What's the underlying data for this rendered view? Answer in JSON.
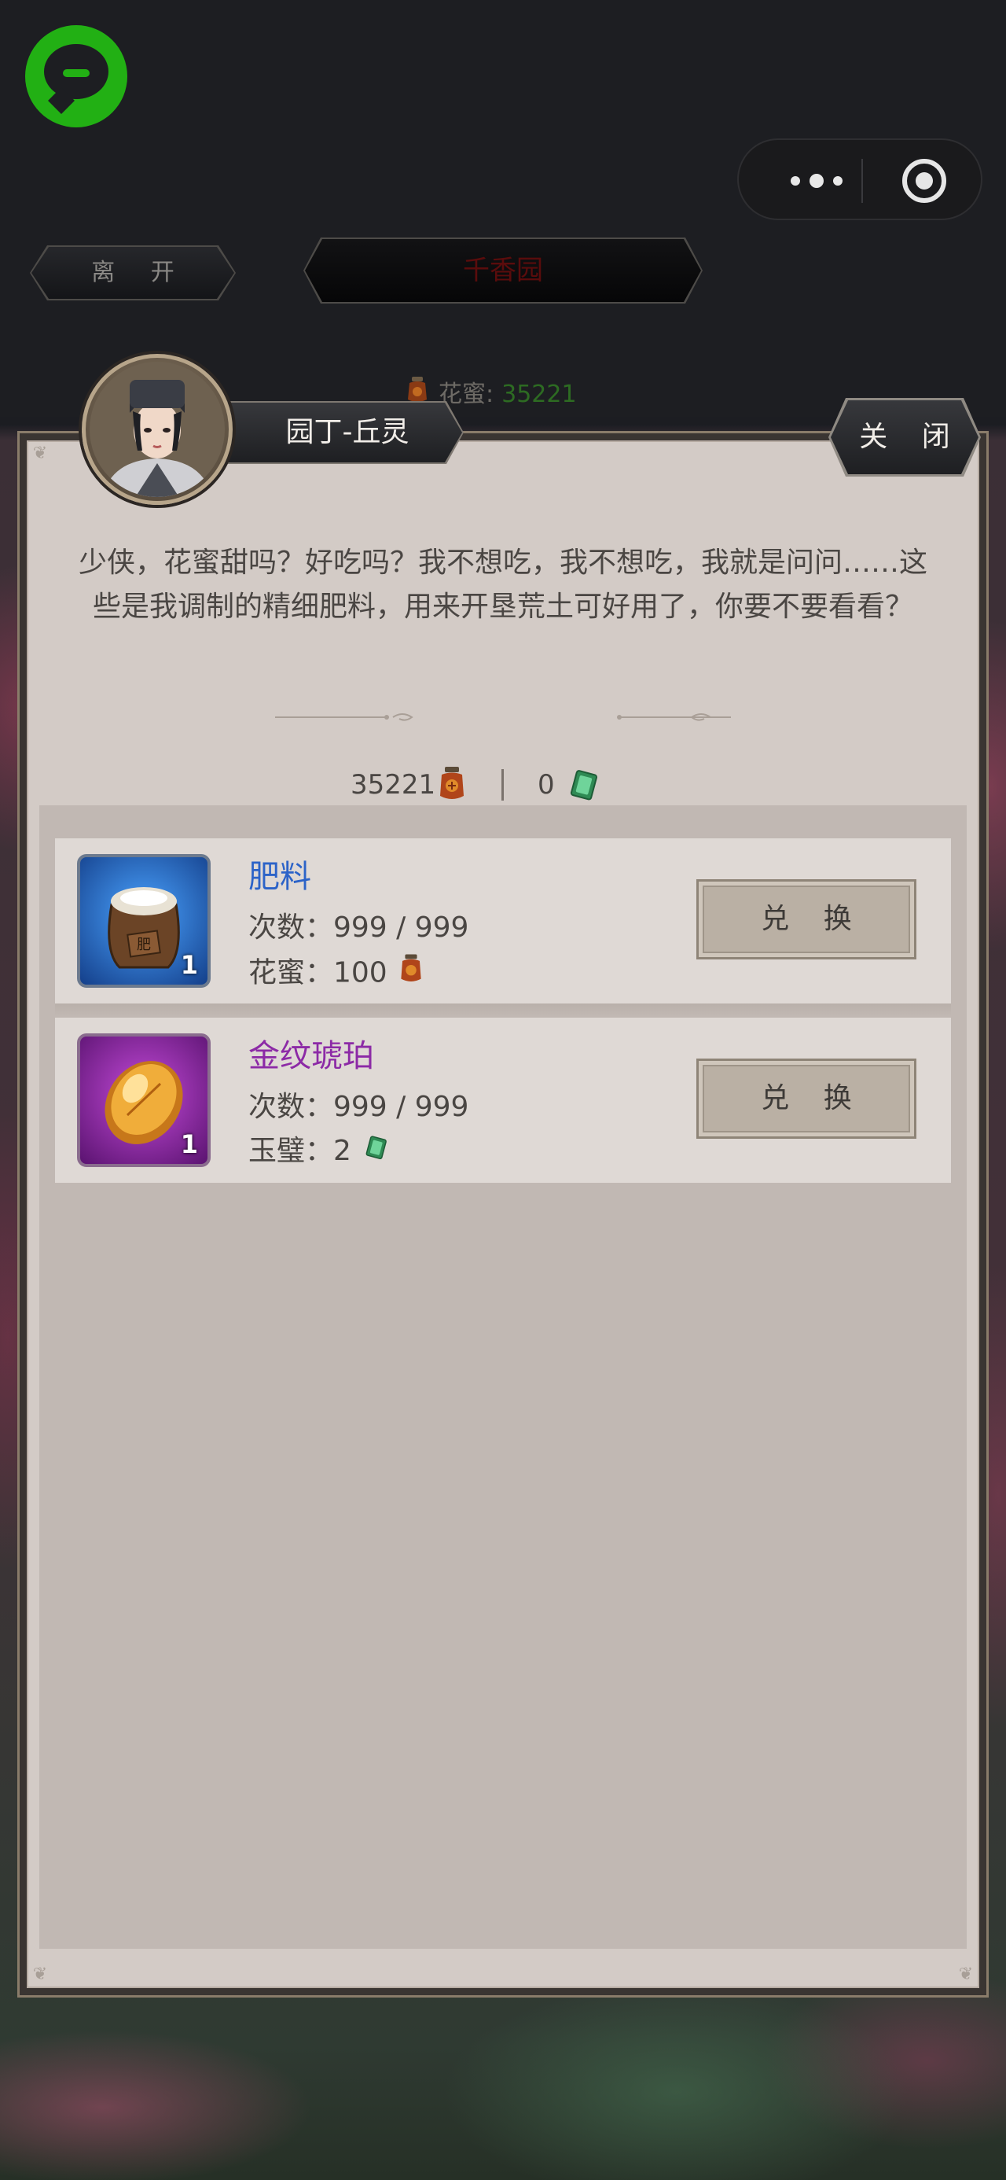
{
  "topnav": {
    "leave_label": "离 开",
    "location_title": "千香园"
  },
  "header_honey": {
    "label": "花蜜:",
    "value": "35221"
  },
  "npc": {
    "name": "园丁-丘灵",
    "close_label": "关 闭",
    "dialogue": "少侠，花蜜甜吗？好吃吗？我不想吃，我不想吃，我就是问问……这些是我调制的精细肥料，用来开垦荒土可好用了，你要不要看看？"
  },
  "currencies": {
    "honey_amount": "35221",
    "jade_amount": "0"
  },
  "items": [
    {
      "name": "肥料",
      "name_color": "#2c63c8",
      "count_text": "次数：999 / 999",
      "cost_text": "花蜜：100",
      "cost_icon": "honey-jar-icon",
      "quantity": "1",
      "frame_color": "#3d8ae0",
      "button_label": "兑 换"
    },
    {
      "name": "金纹琥珀",
      "name_color": "#8c2aa6",
      "count_text": "次数：999 / 999",
      "cost_text": "玉璧：2",
      "cost_icon": "jade-icon",
      "quantity": "1",
      "frame_color": "#a12cc1",
      "button_label": "兑 换"
    }
  ],
  "colors": {
    "honey_value_green": "#2d6b22",
    "title_red": "#5a0c0c",
    "brand_green": "#22b014"
  }
}
